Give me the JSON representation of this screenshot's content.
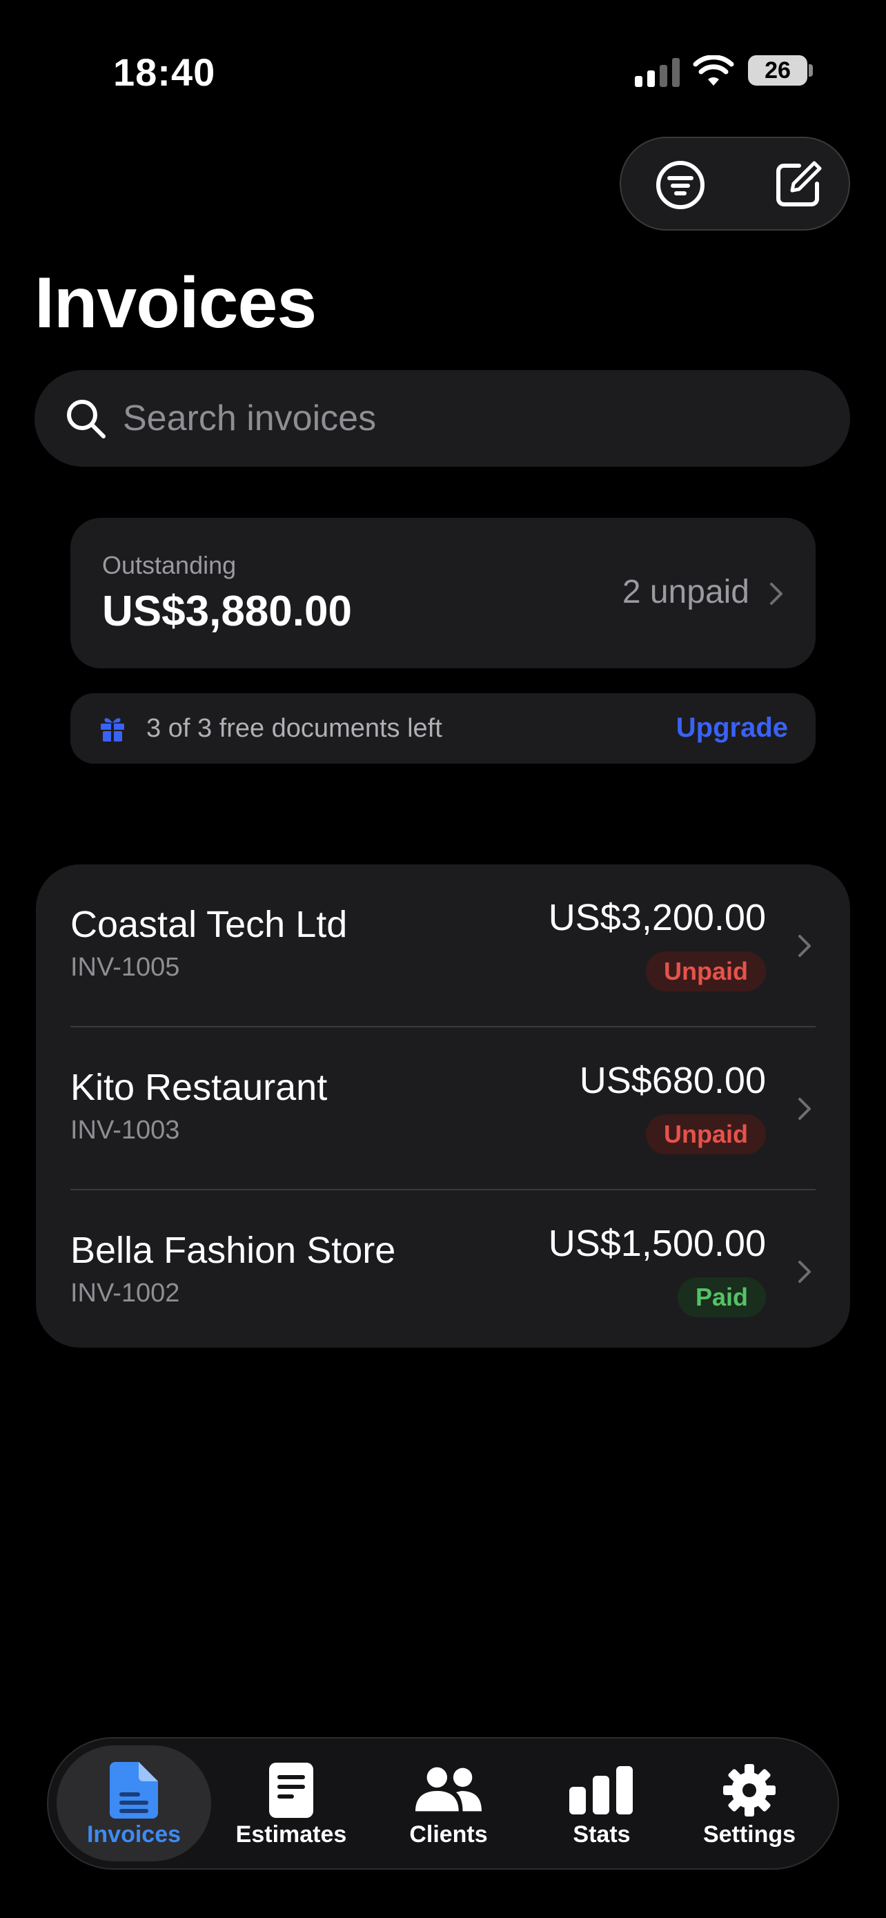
{
  "status_bar": {
    "time": "18:40",
    "battery": "26"
  },
  "header": {
    "title": "Invoices"
  },
  "search": {
    "placeholder": "Search invoices"
  },
  "outstanding": {
    "label": "Outstanding",
    "amount": "US$3,880.00",
    "unpaid_count": "2 unpaid"
  },
  "promo": {
    "text": "3 of 3 free documents left",
    "action": "Upgrade"
  },
  "invoices": [
    {
      "client": "Coastal Tech Ltd",
      "number": "INV-1005",
      "amount": "US$3,200.00",
      "status": "Unpaid"
    },
    {
      "client": "Kito Restaurant",
      "number": "INV-1003",
      "amount": "US$680.00",
      "status": "Unpaid"
    },
    {
      "client": "Bella Fashion Store",
      "number": "INV-1002",
      "amount": "US$1,500.00",
      "status": "Paid"
    }
  ],
  "tabs": [
    {
      "label": "Invoices",
      "icon": "document-icon",
      "active": true
    },
    {
      "label": "Estimates",
      "icon": "estimate-icon",
      "active": false
    },
    {
      "label": "Clients",
      "icon": "people-icon",
      "active": false
    },
    {
      "label": "Stats",
      "icon": "bar-chart-icon",
      "active": false
    },
    {
      "label": "Settings",
      "icon": "gear-icon",
      "active": false
    }
  ],
  "colors": {
    "accent_blue": "#3d8bf5",
    "link_blue": "#3a62f5",
    "unpaid_red": "#e5534b",
    "paid_green": "#55c267",
    "card_bg": "#1c1c1e"
  }
}
